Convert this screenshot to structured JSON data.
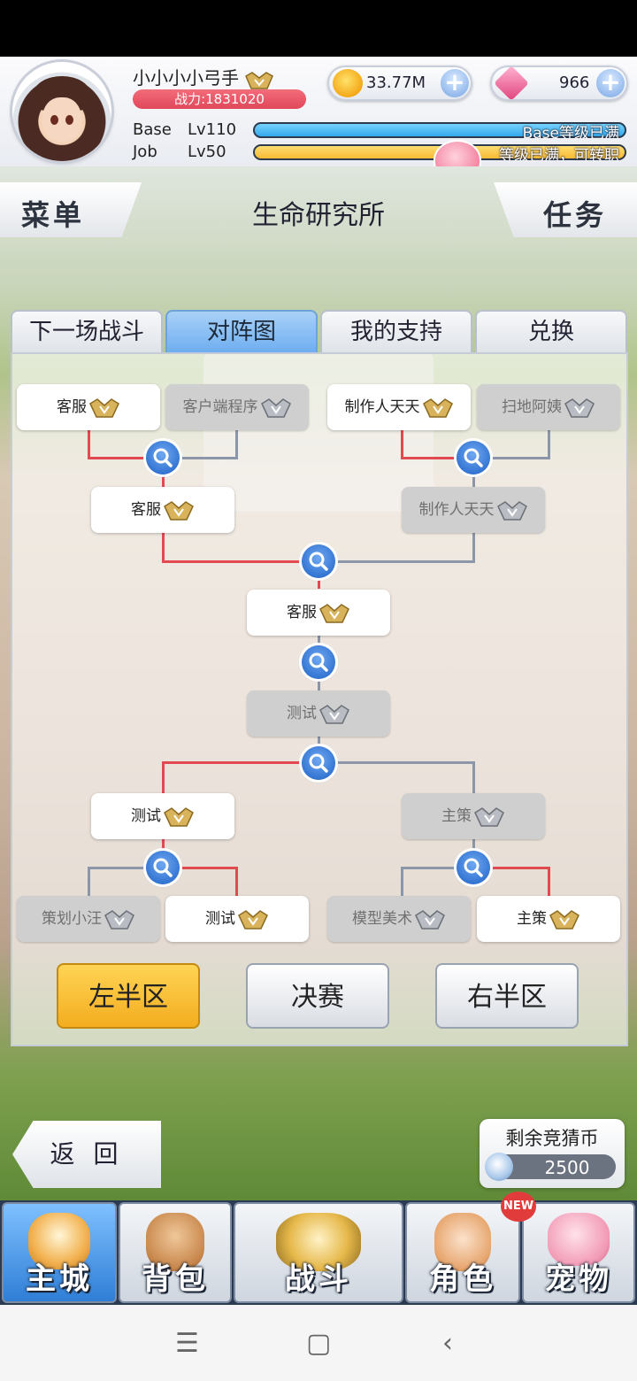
{
  "player": {
    "name": "小小小小弓手",
    "power": "战力:1831020",
    "base_label": "Base",
    "base_level": "Lv110",
    "base_status": "Base等级已满",
    "job_label": "Job",
    "job_level": "Lv50",
    "job_status": "等级已满，可转职"
  },
  "currency": {
    "gold": "33.77M",
    "gems": "966"
  },
  "nav_top": {
    "menu": "菜单",
    "title": "生命研究所",
    "task": "任务"
  },
  "tabs": [
    "下一场战斗",
    "对阵图",
    "我的支持",
    "兑换"
  ],
  "active_tab": "对阵图",
  "bracket": {
    "round1_top": [
      "客服",
      "客户端程序",
      "制作人天天",
      "扫地阿姨"
    ],
    "round2_top": [
      "客服",
      "制作人天天"
    ],
    "final_top": "客服",
    "final_bottom": "测试",
    "round2_bottom": [
      "测试",
      "主策"
    ],
    "round1_bottom": [
      "策划小汪",
      "测试",
      "模型美术",
      "主策"
    ]
  },
  "sections": {
    "left": "左半区",
    "final": "决赛",
    "right": "右半区",
    "active": "左半区"
  },
  "back_button": "返 回",
  "guess_coins": {
    "label": "剩余竞猜币",
    "value": "2500"
  },
  "bottom_nav": {
    "items": [
      "主城",
      "背包",
      "战斗",
      "角色",
      "宠物"
    ],
    "active": "主城",
    "new_badge": "NEW"
  },
  "colors": {
    "win_line": "#e24a52",
    "lose_line": "#8b96a8",
    "active_tab": "#6eaef0",
    "active_section": "#f3ad1f"
  }
}
